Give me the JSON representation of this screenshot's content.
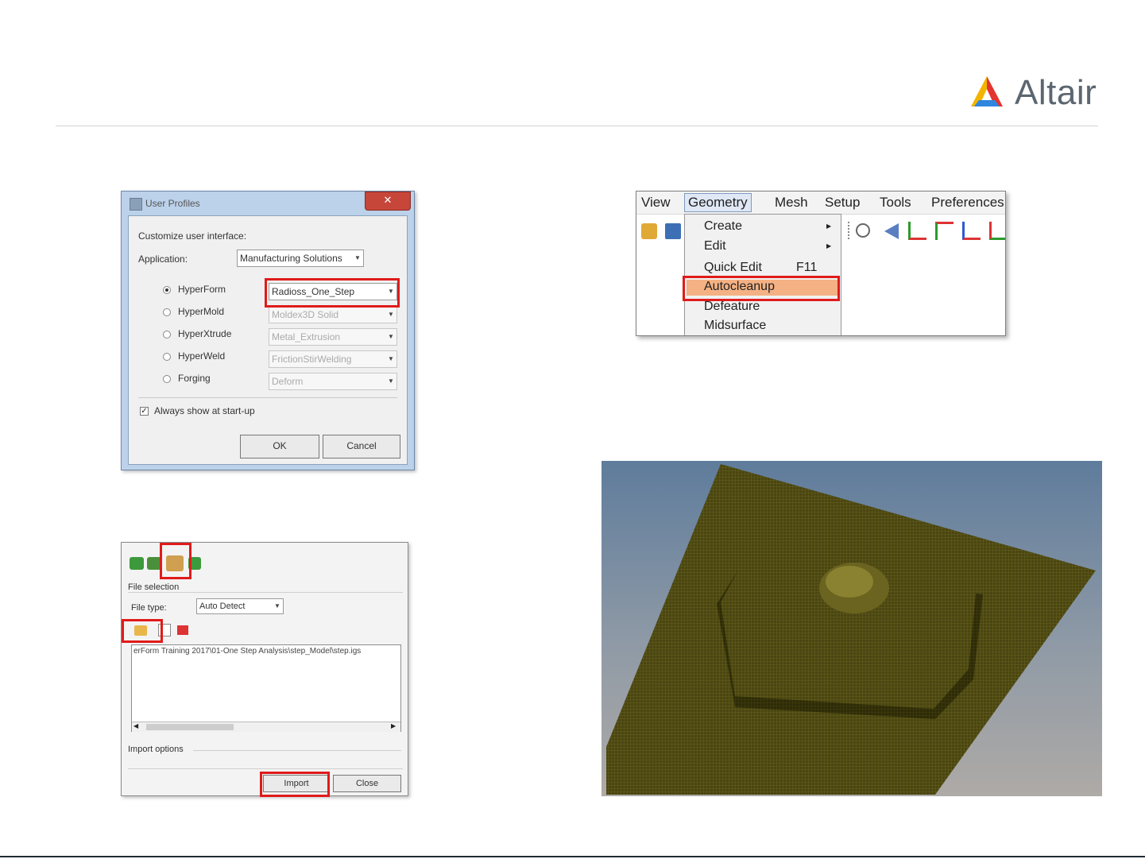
{
  "brand": {
    "name": "Altair"
  },
  "user_profiles": {
    "title": "User Profiles",
    "close_glyph": "✕",
    "customize_label": "Customize user interface:",
    "application_label": "Application:",
    "application_value": "Manufacturing Solutions",
    "options": [
      {
        "label": "HyperForm",
        "selected": true,
        "value": "Radioss_One_Step"
      },
      {
        "label": "HyperMold",
        "selected": false,
        "value": "Moldex3D Solid"
      },
      {
        "label": "HyperXtrude",
        "selected": false,
        "value": "Metal_Extrusion"
      },
      {
        "label": "HyperWeld",
        "selected": false,
        "value": "FrictionStirWelding"
      },
      {
        "label": "Forging",
        "selected": false,
        "value": "Deform"
      }
    ],
    "always_show_label": "Always show at start-up",
    "always_show_checked": true,
    "ok_label": "OK",
    "cancel_label": "Cancel"
  },
  "menu": {
    "menubar": [
      "View",
      "Geometry",
      "Mesh",
      "Setup",
      "Tools",
      "Preferences"
    ],
    "geometry_items": [
      {
        "label": "Create",
        "submenu": true,
        "shortcut": ""
      },
      {
        "label": "Edit",
        "submenu": true,
        "shortcut": ""
      },
      {
        "label": "Quick Edit",
        "submenu": false,
        "shortcut": "F11"
      },
      {
        "label": "Autocleanup",
        "submenu": false,
        "shortcut": "",
        "highlighted": true
      },
      {
        "label": "Defeature",
        "submenu": false,
        "shortcut": ""
      },
      {
        "label": "Midsurface",
        "submenu": false,
        "shortcut": ""
      }
    ]
  },
  "import_panel": {
    "file_selection_label": "File selection",
    "file_type_label": "File type:",
    "file_type_value": "Auto Detect",
    "file_path": "erForm Training 2017\\01-One Step Analysis\\step_Model\\step.igs",
    "import_options_label": "Import options",
    "import_label": "Import",
    "close_label": "Close"
  },
  "colors": {
    "highlight_box": "#e01b1b",
    "menu_highlight": "#f4b183",
    "mesh": "#4a4512"
  }
}
